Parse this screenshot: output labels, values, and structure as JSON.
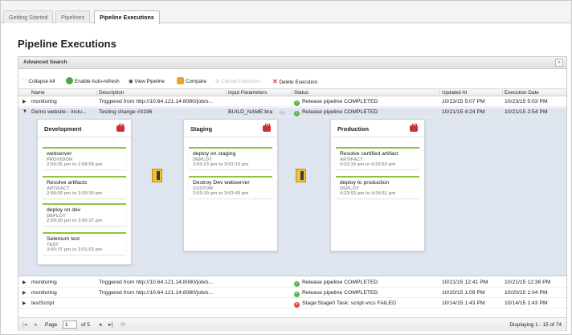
{
  "tabs": [
    {
      "label": "Getting Started"
    },
    {
      "label": "Pipelines"
    },
    {
      "label": "Pipeline Executions"
    }
  ],
  "page_title": "Pipeline Executions",
  "advanced_search": {
    "label": "Advanced Search"
  },
  "toolbar": {
    "collapse_all": "Collapse All",
    "enable_auto_refresh": "Enable Auto-refresh",
    "view_pipeline": "View Pipeline",
    "compare": "Compare",
    "cancel_execution": "Cancel Execution",
    "delete_execution": "Delete Execution"
  },
  "columns": [
    "Name",
    "Description",
    "Input Parameters",
    "Status",
    "Updated At",
    "Execution Date"
  ],
  "rows": [
    {
      "name": "monitoring",
      "description": "Triggered from http://10.64.121.14:8080/job/o...",
      "input": "",
      "status": "Release pipeline COMPLETED",
      "status_type": "ok",
      "updated": "10/23/15 5:07 PM",
      "date": "10/23/15 5:03 PM"
    },
    {
      "name": "Demo website - inclu...",
      "description": "Testing change #3196",
      "input": "BUILD_NAME:bra",
      "status": "Release pipeline COMPLETED",
      "status_type": "ok",
      "updated": "10/21/15 4:24 PM",
      "date": "10/21/15 2:54 PM"
    },
    {
      "name": "monitoring",
      "description": "Triggered from http://10.64.121.14:8080/job/o...",
      "input": "",
      "status": "Release pipeline COMPLETED",
      "status_type": "ok",
      "updated": "10/21/15 12:41 PM",
      "date": "10/21/15 12:36 PM"
    },
    {
      "name": "monitoring",
      "description": "Triggered from http://10.64.121.14:8080/job/o...",
      "input": "",
      "status": "Release pipeline COMPLETED",
      "status_type": "ok",
      "updated": "10/20/15 1:09 PM",
      "date": "10/20/15 1:04 PM"
    },
    {
      "name": "testScript",
      "description": "",
      "input": "",
      "status": "Stage:Stage0 Task: script-vrcs FAILED",
      "status_type": "fail",
      "updated": "10/14/15 1:43 PM",
      "date": "10/14/15 1:43 PM"
    }
  ],
  "stages": [
    {
      "title": "Development",
      "tasks": [
        {
          "name": "webserver",
          "type": "PROVISION",
          "time": "2:54:26 pm to 2:58:59 pm"
        },
        {
          "name": "Resolve artifacts",
          "type": "ARTIFACT",
          "time": "2:58:59 pm to 2:59:30 pm"
        },
        {
          "name": "deploy on dev",
          "type": "DEPLOY",
          "time": "2:59:30 pm to 3:00:37 pm"
        },
        {
          "name": "Selenium test",
          "type": "TEST",
          "time": "3:00:37 pm to 3:01:53 pm"
        }
      ]
    },
    {
      "title": "Staging",
      "tasks": [
        {
          "name": "deploy on staging",
          "type": "DEPLOY",
          "time": "3:02:23 pm to 3:03:19 pm"
        },
        {
          "name": "Destroy Dev webserver",
          "type": "CUSTOM",
          "time": "3:03:19 pm to 3:03:49 pm"
        }
      ]
    },
    {
      "title": "Production",
      "tasks": [
        {
          "name": "Resolve certified artifact",
          "type": "ARTIFACT",
          "time": "4:23:19 pm to 4:23:53 pm"
        },
        {
          "name": "deploy to production",
          "type": "DEPLOY",
          "time": "4:23:53 pm to 4:24:51 pm"
        }
      ]
    }
  ],
  "pager": {
    "page_label": "Page",
    "page_value": "1",
    "of_label": "of 5",
    "displaying": "Displaying 1 - 15 of 74"
  },
  "colors": {
    "accent_green": "#8cc63f",
    "ok": "#5db24a",
    "fail": "#d9483b",
    "expanded_bg": "#dfe5ef"
  }
}
